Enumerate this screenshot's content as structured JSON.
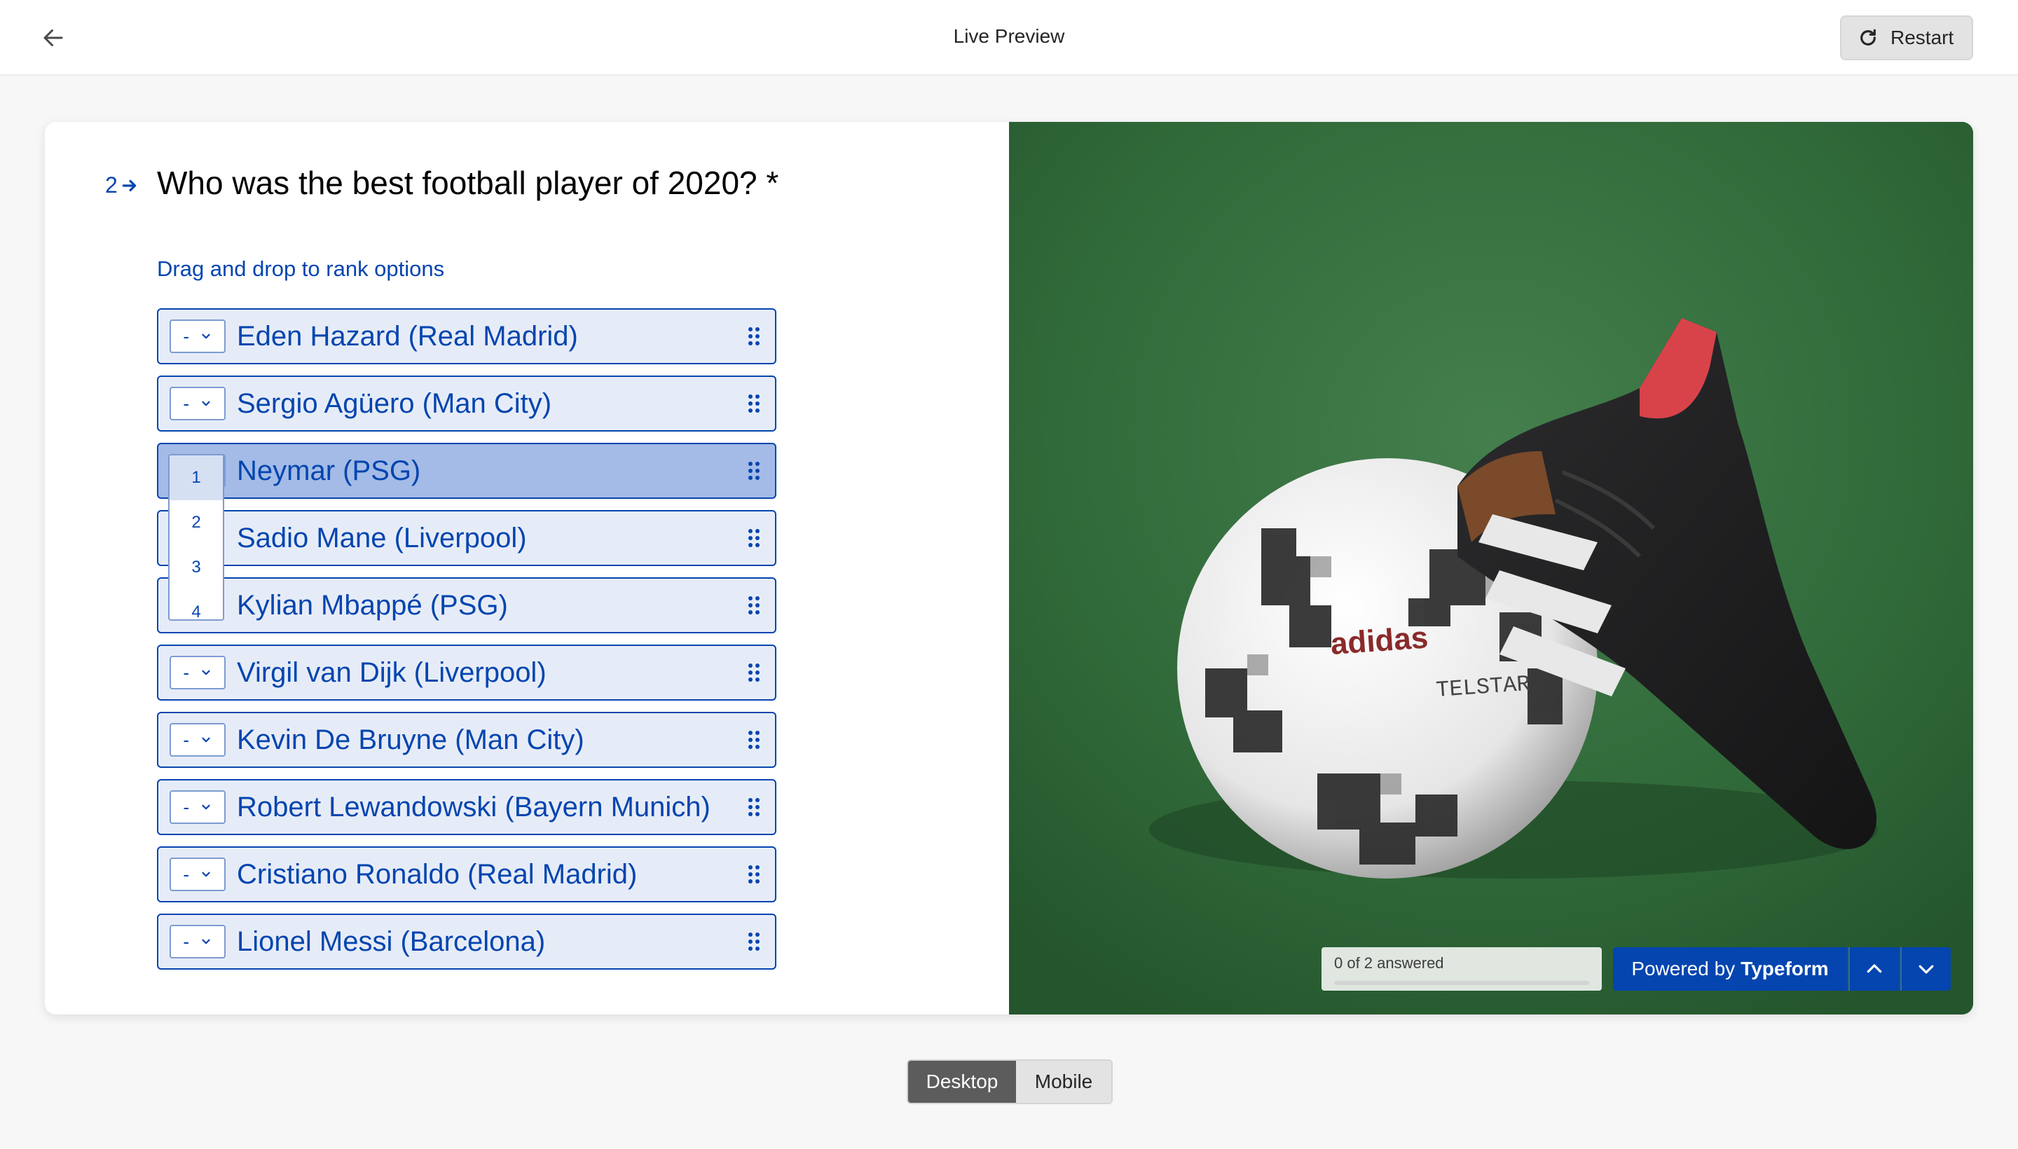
{
  "topbar": {
    "title": "Live Preview",
    "restart_label": "Restart"
  },
  "question": {
    "number": "2",
    "title": "Who was the best football player of 2020? *",
    "instructions": "Drag and drop to rank options",
    "options": [
      {
        "label": "Eden Hazard (Real Madrid)",
        "rank": "-"
      },
      {
        "label": "Sergio Agüero (Man City)",
        "rank": "-"
      },
      {
        "label": "Neymar (PSG)",
        "rank": "-"
      },
      {
        "label": "Sadio Mane (Liverpool)",
        "rank": "-"
      },
      {
        "label": "Kylian Mbappé (PSG)",
        "rank": "-"
      },
      {
        "label": "Virgil van Dijk (Liverpool)",
        "rank": "-"
      },
      {
        "label": "Kevin De Bruyne (Man City)",
        "rank": "-"
      },
      {
        "label": "Robert Lewandowski (Bayern Munich)",
        "rank": "-"
      },
      {
        "label": "Cristiano Ronaldo (Real Madrid)",
        "rank": "-"
      },
      {
        "label": "Lionel Messi (Barcelona)",
        "rank": "-"
      }
    ],
    "dropdown_options": [
      "1",
      "2",
      "3",
      "4"
    ]
  },
  "progress": {
    "text": "0 of 2 answered",
    "fraction": 0
  },
  "powered": {
    "prefix": "Powered by",
    "brand": "Typeform"
  },
  "image": {
    "ball_brand_text": "adidas",
    "ball_model_text": "TELSTAR"
  },
  "device_toggle": {
    "desktop_label": "Desktop",
    "mobile_label": "Mobile"
  },
  "colors": {
    "accent": "#0445af",
    "option_bg": "#e6ecf7",
    "option_active_bg": "#a3bbe6",
    "grass": "#2f6839"
  }
}
